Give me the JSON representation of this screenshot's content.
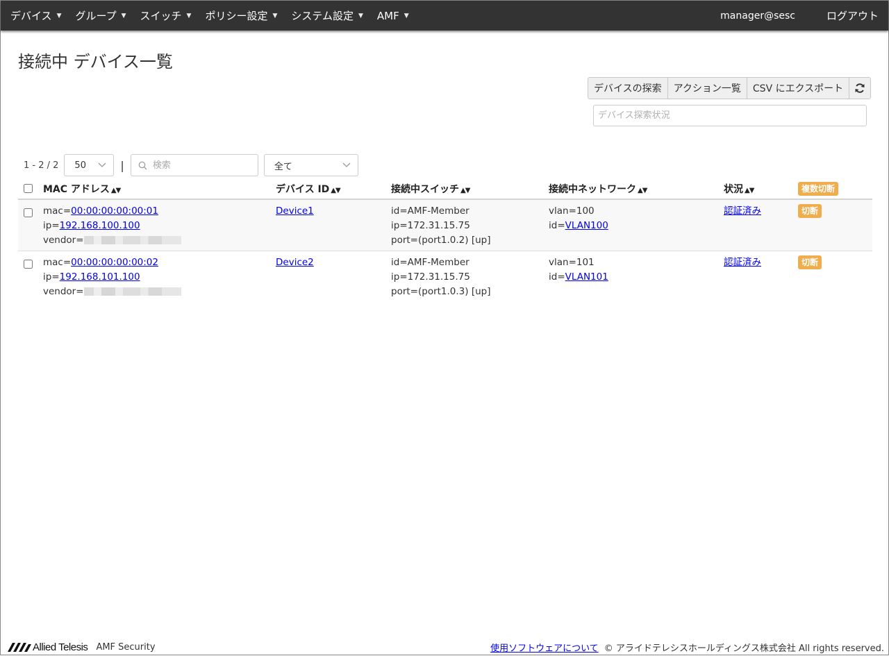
{
  "nav": {
    "items": [
      {
        "label": "デバイス"
      },
      {
        "label": "グループ"
      },
      {
        "label": "スイッチ"
      },
      {
        "label": "ポリシー設定"
      },
      {
        "label": "システム設定"
      },
      {
        "label": "AMF"
      }
    ],
    "user": "manager@sesc",
    "logout": "ログアウト"
  },
  "page": {
    "title": "接続中 デバイス一覧"
  },
  "actions": {
    "discover": "デバイスの探索",
    "action_list": "アクション一覧",
    "export_csv": "CSV にエクスポート",
    "refresh_icon": "refresh-icon"
  },
  "status_field": {
    "placeholder": "デバイス探索状況"
  },
  "toolbar": {
    "range": "1 - 2 / 2",
    "page_size": "50",
    "separator": "|",
    "search_placeholder": "検索",
    "filter": "全て"
  },
  "table": {
    "headers": {
      "mac": "MAC アドレス",
      "device_id": "デバイス ID",
      "switch": "接続中スイッチ",
      "network": "接続中ネットワーク",
      "status": "状況",
      "bulk_disconnect": "複数切断"
    },
    "rows": [
      {
        "mac_prefix": "mac=",
        "mac": "00:00:00:00:00:01",
        "ip_prefix": "ip=",
        "ip": "192.168.100.100",
        "vendor_prefix": "vendor=",
        "device_id": "Device1",
        "switch_id": "id=AMF-Member",
        "switch_ip": "ip=172.31.15.75",
        "switch_port": "port=(port1.0.2) [up]",
        "vlan": "vlan=100",
        "net_id_prefix": "id=",
        "net_id": "VLAN100",
        "status": "認証済み",
        "disconnect": "切断"
      },
      {
        "mac_prefix": "mac=",
        "mac": "00:00:00:00:00:02",
        "ip_prefix": "ip=",
        "ip": "192.168.101.100",
        "vendor_prefix": "vendor=",
        "device_id": "Device2",
        "switch_id": "id=AMF-Member",
        "switch_ip": "ip=172.31.15.75",
        "switch_port": "port=(port1.0.3) [up]",
        "vlan": "vlan=101",
        "net_id_prefix": "id=",
        "net_id": "VLAN101",
        "status": "認証済み",
        "disconnect": "切断"
      }
    ]
  },
  "footer": {
    "logo_text": "Allied Telesis",
    "product": "AMF Security",
    "software_link": "使用ソフトウェアについて",
    "copyright": "© アライドテレシスホールディングス株式会社 All rights reserved."
  },
  "colors": {
    "navbar": "#333333",
    "badge": "#f0ad4e",
    "link": "#0000ee"
  }
}
